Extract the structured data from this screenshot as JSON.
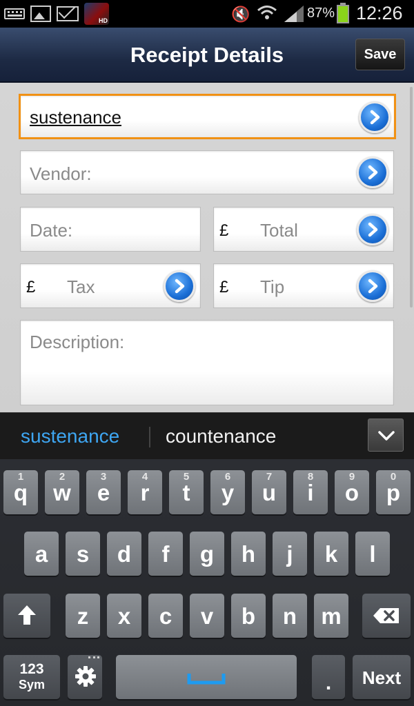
{
  "status_bar": {
    "battery": "87%",
    "time": "12:26",
    "icons": [
      "keyboard-icon",
      "image-icon",
      "mail-icon",
      "app-icon",
      "mute-icon",
      "wifi-icon",
      "signal-icon",
      "battery-icon"
    ]
  },
  "header": {
    "title": "Receipt Details",
    "save_label": "Save"
  },
  "form": {
    "category_value": "sustenance",
    "vendor_placeholder": "Vendor:",
    "date_placeholder": "Date:",
    "currency_symbol": "£",
    "total_placeholder": "Total",
    "tax_placeholder": "Tax",
    "tip_placeholder": "Tip",
    "description_placeholder": "Description:"
  },
  "suggestions": [
    "sustenance",
    "countenance"
  ],
  "keyboard": {
    "row1": [
      {
        "letter": "q",
        "num": "1"
      },
      {
        "letter": "w",
        "num": "2"
      },
      {
        "letter": "e",
        "num": "3"
      },
      {
        "letter": "r",
        "num": "4"
      },
      {
        "letter": "t",
        "num": "5"
      },
      {
        "letter": "y",
        "num": "6"
      },
      {
        "letter": "u",
        "num": "7"
      },
      {
        "letter": "i",
        "num": "8"
      },
      {
        "letter": "o",
        "num": "9"
      },
      {
        "letter": "p",
        "num": "0"
      }
    ],
    "row2": [
      "a",
      "s",
      "d",
      "f",
      "g",
      "h",
      "j",
      "k",
      "l"
    ],
    "row3": [
      "z",
      "x",
      "c",
      "v",
      "b",
      "n",
      "m"
    ],
    "sym_label": "123",
    "sym_sub_label": "Sym",
    "period": ".",
    "next_label": "Next"
  },
  "colors": {
    "focus_border": "#f19114",
    "suggestion_primary": "#3ea6f2",
    "space_bar_mark": "#1e9bf0",
    "battery_fill": "#8ad41a"
  }
}
